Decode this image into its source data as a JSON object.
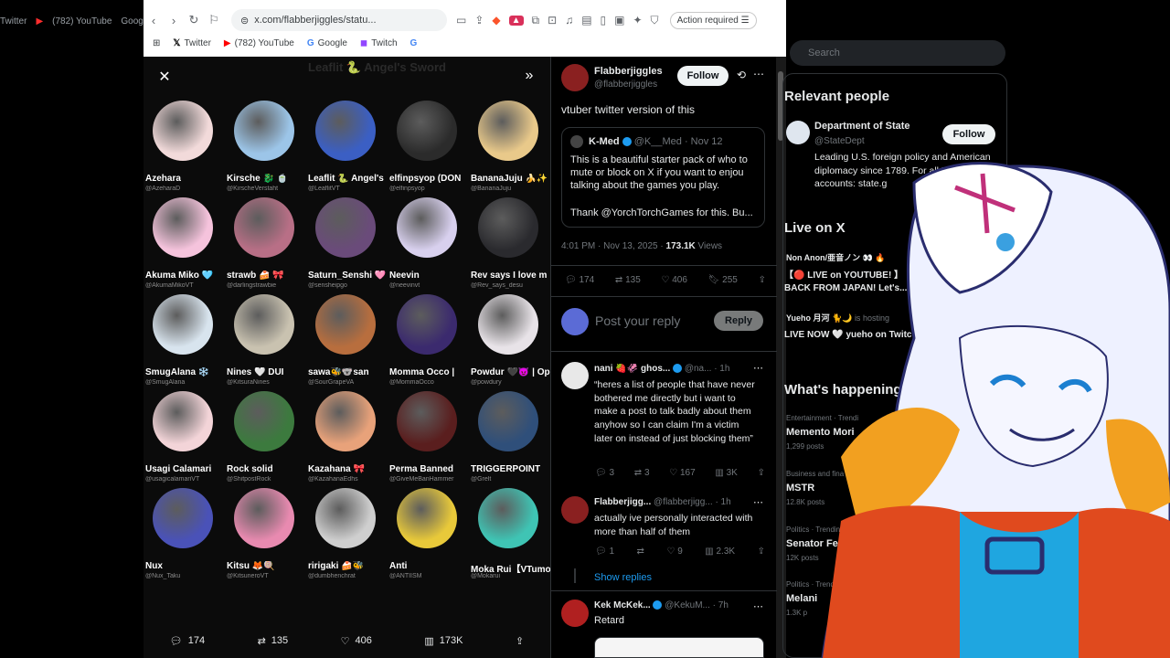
{
  "background": {
    "bookmarks": [
      "Twitter",
      "(782) YouTube",
      "Goog"
    ]
  },
  "browser": {
    "url": "x.com/flabberjiggles/statu...",
    "action_required": "Action required",
    "bookmarks": [
      {
        "icon": "x-icon",
        "label": "Twitter"
      },
      {
        "icon": "youtube-icon",
        "label": "(782) YouTube"
      },
      {
        "icon": "google-icon",
        "label": "Google"
      },
      {
        "icon": "twitch-icon",
        "label": "Twitch"
      },
      {
        "icon": "google-icon",
        "label": ""
      }
    ]
  },
  "viewer": {
    "ghost_title": "Leaflit 🐍 Angel's Sword",
    "cells": [
      {
        "name": "Azehara",
        "handle": "@AzeharaD",
        "color": "#f2dada"
      },
      {
        "name": "Kirsche 🐉 🍵",
        "handle": "@KirscheVerstaht",
        "color": "#9cc5e8"
      },
      {
        "name": "Leaflit 🐍 Angel's",
        "handle": "@LeaflitVT",
        "color": "#3b5fc4"
      },
      {
        "name": "elfinpsyop (DON",
        "handle": "@elfinpsyop",
        "color": "#2b2b2b"
      },
      {
        "name": "BananaJuju 🍌✨",
        "handle": "@BananaJuju",
        "color": "#e9c98a"
      },
      {
        "name": "Akuma Miko 🩵",
        "handle": "@AkumaMikoVT",
        "color": "#f5c3dc"
      },
      {
        "name": "strawb 🍰 🎀",
        "handle": "@darlingstrawbie",
        "color": "#b86f86"
      },
      {
        "name": "Saturn_Senshi 🩷",
        "handle": "@sensheipgo",
        "color": "#6a4b7a"
      },
      {
        "name": "Neevin",
        "handle": "@neevinvt",
        "color": "#d8d0ee"
      },
      {
        "name": "Rev says I love m",
        "handle": "@Rev_says_desu",
        "color": "#2a2a2e"
      },
      {
        "name": "SmugAlana ❄️",
        "handle": "@SmugAlana",
        "color": "#d8e4ee"
      },
      {
        "name": "Nines 🤍 DUI",
        "handle": "@KitsuraNines",
        "color": "#c9c2b0"
      },
      {
        "name": "sawa🐝🐨san",
        "handle": "@SourGrapeVA",
        "color": "#b86e3e"
      },
      {
        "name": "Momma Occo |",
        "handle": "@MommaOcco",
        "color": "#3b2a6e"
      },
      {
        "name": "Powdur 🖤😈 | Op",
        "handle": "@powdury",
        "color": "#e8e3e8"
      },
      {
        "name": "Usagi Calamari",
        "handle": "@usagicalamariVT",
        "color": "#f3d4d8"
      },
      {
        "name": "Rock solid",
        "handle": "@ShitpostRock",
        "color": "#3c7a3e"
      },
      {
        "name": "Kazahana 🎀",
        "handle": "@KazahanaEdhs",
        "color": "#e8a27a"
      },
      {
        "name": "Perma Banned",
        "handle": "@GiveMeBanHammer",
        "color": "#5a1e1e"
      },
      {
        "name": "TRIGGERPOINT",
        "handle": "@Grelt",
        "color": "#2f4f7a"
      },
      {
        "name": "Nux",
        "handle": "@Nux_Taku",
        "color": "#4a52b8"
      },
      {
        "name": "Kitsu 🦊🍭",
        "handle": "@KitsuneroVT",
        "color": "#e88ab0"
      },
      {
        "name": "ririgaki 🍰🐝",
        "handle": "@dumbhenchrat",
        "color": "#cfcfcf"
      },
      {
        "name": "Anti",
        "handle": "@ANTIISM",
        "color": "#e8c93a"
      },
      {
        "name": "Moka Rui【VTumor",
        "handle": "@Mokarui",
        "color": "#3fc4b4"
      }
    ],
    "actions": {
      "replies": "174",
      "reposts": "135",
      "likes": "406",
      "views": "173K"
    }
  },
  "tweet": {
    "author_name": "Flabberjiggles",
    "author_handle": "@flabberjiggles",
    "follow_label": "Follow",
    "text": "vtuber twitter version of this",
    "quote": {
      "name": "K-Med",
      "handle": "@K__Med",
      "date": "· Nov 12",
      "text": "This is a beautiful starter pack of who to mute or block on X if you want to enjou talking about the games you play.",
      "text2": "Thank @YorchTorchGames for this. Bu..."
    },
    "timestamp": "4:01 PM · Nov 13, 2025 ·",
    "views_count": "173.1K",
    "views_label": "Views",
    "stats": {
      "replies": "174",
      "reposts": "135",
      "likes": "406",
      "bookmarks": "255"
    },
    "reply_placeholder": "Post your reply",
    "reply_button": "Reply",
    "replies": [
      {
        "name": "nani 🍓🦑 ghos...",
        "handle": "@na...",
        "time": "· 1h",
        "text": "“heres a list of people that have never bothered me directly but i want to make a post to talk badly about them anyhow so I can claim I'm a victim later on instead of just blocking them”",
        "stats": {
          "replies": "3",
          "reposts": "3",
          "likes": "167",
          "views": "3K"
        }
      },
      {
        "name": "Flabberjigg...",
        "handle": "@flabberjigg...",
        "time": "· 1h",
        "text": "actually ive personally interacted with more than half of them",
        "stats": {
          "replies": "1",
          "reposts": "",
          "likes": "9",
          "views": "2.3K"
        }
      },
      {
        "name": "Kek McKek...",
        "handle": "@KekuM...",
        "time": "· 7h",
        "text": "Retard"
      }
    ],
    "show_replies": "Show replies"
  },
  "sidebar": {
    "search_placeholder": "Search",
    "relevant_title": "Relevant people",
    "relevant": {
      "name": "Department of State",
      "handle": "@StateDept",
      "follow_label": "Follow",
      "bio": "Leading U.S. foreign policy and American diplomacy since 1789. For all Department accounts: state.g"
    },
    "live_title": "Live on X",
    "live": [
      {
        "name": "Non Anon/亜音ノン 👀 🔥",
        "text": "【🔴 LIVE on YOUTUBE! 】 BACK FROM JAPAN! Let's..."
      },
      {
        "name": "Yueho 月河 🐈🌙",
        "status": "is hosting",
        "text": "LIVE NOW 🤍 yueho on Twitc"
      }
    ],
    "happening_title": "What's happening",
    "trends": [
      {
        "context": "Entertainment · Trendi",
        "name": "Memento Mori",
        "count": "1,299 posts"
      },
      {
        "context": "Business and fina",
        "name": "MSTR",
        "count": "12.8K posts"
      },
      {
        "context": "Politics · Trending",
        "name": "Senator Fett",
        "count": "12K posts"
      },
      {
        "context": "Politics · Trendi",
        "name": "Melani",
        "count": "1.3K p"
      }
    ]
  }
}
